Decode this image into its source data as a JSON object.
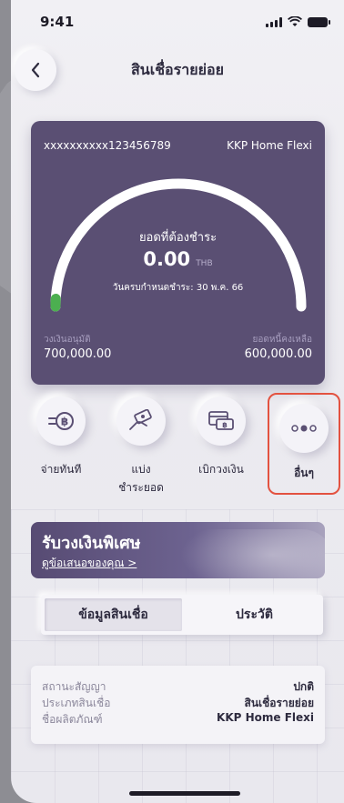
{
  "status_bar": {
    "time": "9:41"
  },
  "nav": {
    "title": "สินเชื่อรายย่อย"
  },
  "loan_card": {
    "account_number": "xxxxxxxxxx123456789",
    "product_name": "KKP Home Flexi",
    "due_label": "ยอดที่ต้องชำระ",
    "due_amount": "0.00",
    "currency": "THB",
    "due_date_text": "วันครบกำหนดชำระ: 30 พ.ค. 66",
    "approved_limit_label": "วงเงินอนุมัติ",
    "approved_limit_value": "700,000.00",
    "remaining_label": "ยอดหนี้คงเหลือ",
    "remaining_value": "600,000.00",
    "gauge_fraction": 0.02,
    "colors": {
      "card": "#5a4f73",
      "gauge_track": "#ffffff",
      "gauge_fill": "#4caf50"
    }
  },
  "actions": [
    {
      "label": "จ่ายทันที",
      "icon": "baht-transfer-icon"
    },
    {
      "label": "แบ่ง\nชำระยอด",
      "icon": "hand-cash-icon"
    },
    {
      "label": "เบิกวงเงิน",
      "icon": "withdraw-card-icon"
    },
    {
      "label": "อื่นๆ",
      "icon": "more-dots-icon"
    }
  ],
  "promo": {
    "title": "รับวงเงินพิเศษ",
    "link": "ดูข้อเสนอของคุณ >"
  },
  "tabs": [
    {
      "label": "ข้อมูลสินเชื่อ",
      "active": true
    },
    {
      "label": "ประวัติ",
      "active": false
    }
  ],
  "info": {
    "rows": [
      {
        "key": "สถานะสัญญา",
        "value": "ปกติ"
      },
      {
        "key": "ประเภทสินเชื่อ",
        "value": "สินเชื่อรายย่อย"
      },
      {
        "key": "ชื่อผลิตภัณฑ์",
        "value": "KKP Home Flexi"
      }
    ]
  },
  "highlight_color": "#e35240"
}
